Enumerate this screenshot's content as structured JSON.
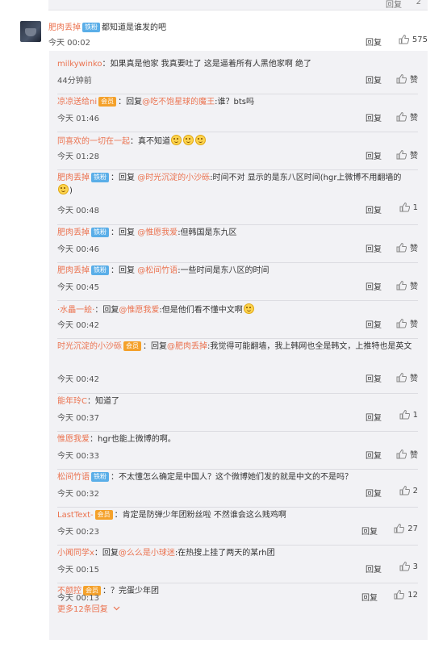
{
  "top": {
    "reply": "回复",
    "like": "2"
  },
  "main": {
    "user": "肥肉丢掉",
    "badge": "铁粉",
    "text": "都知道是谁发的吧",
    "time": "今天 00:02",
    "reply": "回复",
    "likes": "575"
  },
  "replies": [
    {
      "user": "milkywinko",
      "text": "：如果真是他家 我真要吐了 这是逼着所有人黑他家啊 绝了",
      "time": "44分钟前",
      "likes": "赞"
    },
    {
      "user": "凉凉送给ni",
      "badge": "会员",
      "pre": "：回复",
      "mention": "@吃不饱星球的魔王",
      "text": ":谁？bts吗",
      "time": "今天 01:46",
      "likes": "赞"
    },
    {
      "user": "同喜欢的一切在一起",
      "text": "：真不知道",
      "time": "今天 01:28",
      "likes": "赞"
    },
    {
      "user": "肥肉丢掉",
      "badge": "铁粉",
      "pre": "：回复 ",
      "mention": "@时光沉淀的小沙砾",
      "text": ":时间不对 显示的是东八区时间(hgr上微博不用翻墙的",
      "text2": ")",
      "time": "今天 00:48",
      "likes": "1"
    },
    {
      "user": "肥肉丢掉",
      "badge": "铁粉",
      "pre": "：回复 ",
      "mention": "@惟愿我爱",
      "text": ":但韩国是东九区",
      "time": "今天 00:46",
      "likes": "赞"
    },
    {
      "user": "肥肉丢掉",
      "badge": "铁粉",
      "pre": "：回复 ",
      "mention": "@松间竹语",
      "text": ":一些时间是东八区的时间",
      "time": "今天 00:45",
      "likes": "赞"
    },
    {
      "user": "·水畾一絵·",
      "pre": "：回复",
      "mention": "@惟愿我爱",
      "text": ":但是他们看不懂中文啊",
      "time": "今天 00:42",
      "likes": "赞"
    },
    {
      "user": "时光沉淀的小沙砾",
      "badge": "会员",
      "pre": "：回复",
      "mention": "@肥肉丢掉",
      "text": ":我觉得可能翻墙，我上韩网也全是韩文，上推特也是英文",
      "time": "今天 00:42",
      "likes": "赞"
    },
    {
      "user": "能年玲C",
      "text": "：知道了",
      "time": "今天 00:37",
      "likes": "1"
    },
    {
      "user": "惟愿我爱",
      "text": "：hgr也能上微博的啊。",
      "time": "今天 00:33",
      "likes": "赞"
    },
    {
      "user": "松间竹语",
      "badge": "铁粉",
      "text": "：不太懂怎么确定是中国人？这个微博她们发的就是中文的不是吗？",
      "time": "今天 00:32",
      "likes": "2"
    },
    {
      "user": "LastText-",
      "badge": "会员",
      "text": "：肯定是防弹少年团粉丝啦 不然谁会这么贱鸡啊",
      "time": "今天 00:23",
      "likes": "27"
    },
    {
      "user": "小闻同学x",
      "pre": "：回复",
      "mention": "@么么是小球迷",
      "text": ":在热搜上挂了两天的某rh团",
      "time": "今天 00:15",
      "likes": "3"
    },
    {
      "user": "不颜控",
      "badge": "会员",
      "text": "：？完蛋少年团",
      "time": "今天 00:13",
      "likes": "12"
    }
  ],
  "reply_label": "回复",
  "more": "更多12条回复",
  "icons": {
    "like": "thumbs-up-icon",
    "more": "chevron-down-icon"
  },
  "colors": {
    "username": "#eb7350",
    "fan_badge": "#5aaee8",
    "vip_badge": "#f4a12b",
    "panel": "#f2f2f5"
  }
}
